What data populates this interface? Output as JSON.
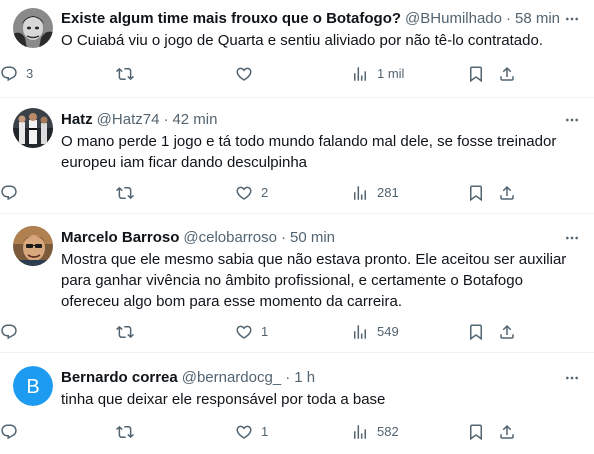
{
  "tweets": [
    {
      "name": "Existe algum time mais frouxo que o Botafogo?",
      "handle": "@BHumilhado",
      "dot": "·",
      "time": "58 min",
      "text": "O Cuiabá viu o jogo de Quarta e sentiu aliviado por não tê-lo contratado.",
      "replies": "3",
      "retweets": "",
      "likes": "",
      "views": "1 mil"
    },
    {
      "name": "Hatz",
      "handle": "@Hatz74",
      "dot": "·",
      "time": "42 min",
      "text": "O mano perde 1 jogo e tá todo mundo falando mal dele, se fosse treinador europeu iam ficar dando desculpinha",
      "replies": "",
      "retweets": "",
      "likes": "2",
      "views": "281"
    },
    {
      "name": "Marcelo Barroso",
      "handle": "@celobarroso",
      "dot": "·",
      "time": "50 min",
      "text": "Mostra que ele mesmo sabia que não estava pronto. Ele aceitou ser auxiliar para ganhar vivência no âmbito profissional, e certamente o Botafogo ofereceu algo bom para esse momento da carreira.",
      "replies": "",
      "retweets": "",
      "likes": "1",
      "views": "549"
    },
    {
      "name": "Bernardo correa",
      "handle": "@bernardocg_",
      "dot": "·",
      "time": "1 h",
      "text": "tinha que deixar ele responsável por toda a base",
      "replies": "",
      "retweets": "",
      "likes": "1",
      "views": "582",
      "avatar_letter": "B"
    }
  ],
  "colors": {
    "text": "#0f1419",
    "secondary": "#536471",
    "divider": "#eff3f4",
    "avatar_b": "#1d9bf0"
  }
}
